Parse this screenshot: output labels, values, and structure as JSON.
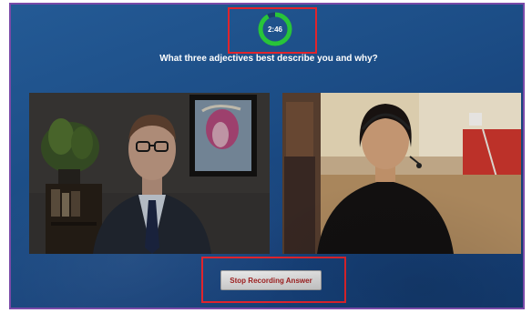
{
  "timer": {
    "display": "2:46",
    "remaining_fraction": 0.92,
    "ring_color": "#28c43a"
  },
  "prompt": {
    "question": "What three adjectives best describe you and why?"
  },
  "videos": {
    "interviewer": {
      "label": "Interviewer video feed"
    },
    "candidate": {
      "label": "Candidate webcam feed"
    }
  },
  "controls": {
    "stop_label": "Stop Recording Answer"
  },
  "colors": {
    "highlight": "#e0242c",
    "frame": "#7a4aa8",
    "background": "#1c4d86"
  }
}
